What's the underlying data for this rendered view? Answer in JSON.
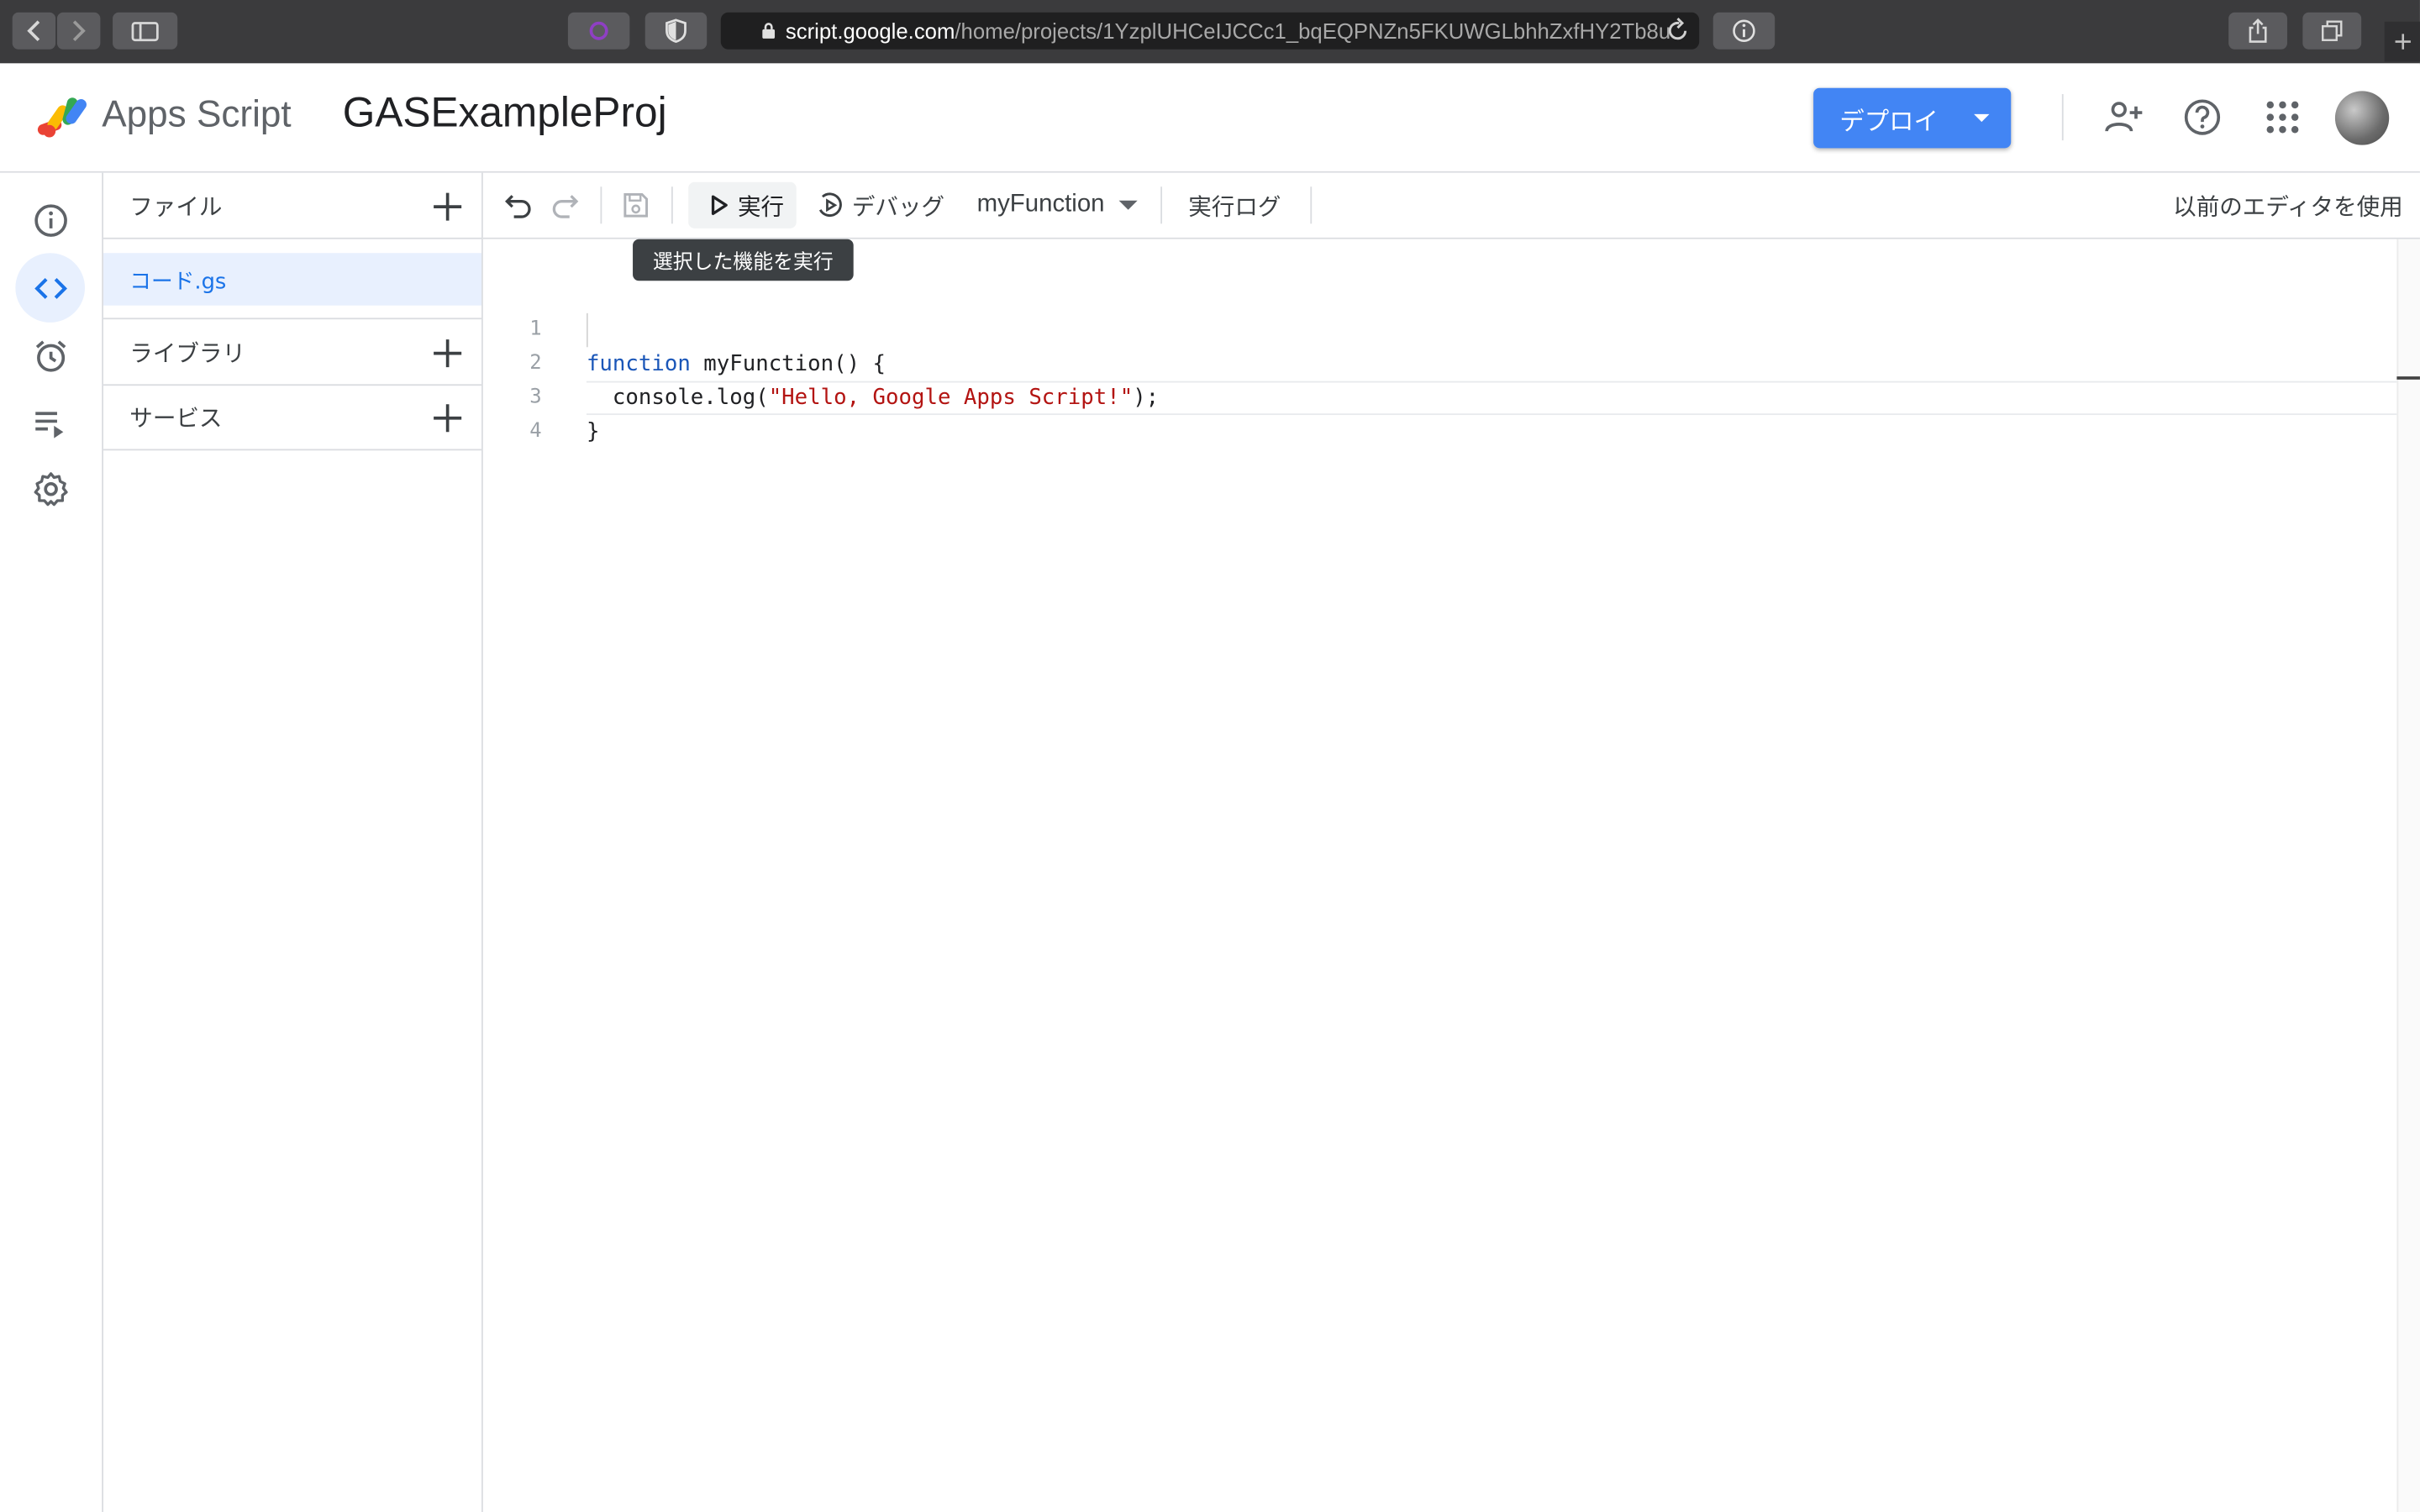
{
  "browser": {
    "url_host": "script.google.com",
    "url_path": "/home/projects/1YzplUHCeIJCCc1_bqEQPNZn5FKUWGLbhhZxfHY2Tb8u",
    "icons": [
      "back-icon",
      "forward-icon",
      "sidebar-icon",
      "extension-icon",
      "shield-icon",
      "lock-icon",
      "reload-icon",
      "info-icon",
      "share-icon",
      "tabs-icon",
      "new-tab-icon"
    ]
  },
  "header": {
    "app_name": "Apps Script",
    "project_title": "GASExampleProj",
    "deploy_label": "デプロイ",
    "accent": "#4285f4",
    "icons": [
      "add-person-icon",
      "help-icon",
      "apps-grid-icon"
    ]
  },
  "rail": {
    "items": [
      "info-icon",
      "code-icon",
      "alarm-icon",
      "executions-icon",
      "settings-icon"
    ],
    "active": "code-icon"
  },
  "files_panel": {
    "files_title": "ファイル",
    "file_name": "コード.gs",
    "libraries_title": "ライブラリ",
    "services_title": "サービス"
  },
  "toolbar": {
    "run_label": "実行",
    "debug_label": "デバッグ",
    "function_name": "myFunction",
    "log_label": "実行ログ",
    "legacy_label": "以前のエディタを使用",
    "tooltip": "選択した機能を実行"
  },
  "editor": {
    "line_numbers": [
      "1",
      "2",
      "3",
      "4"
    ],
    "line1_kw": "function",
    "line1_rest": " myFunction() {",
    "line2_pre": "  console.log(",
    "line2_str": "\"Hello, Google Apps Script!\"",
    "line2_post": ");",
    "line3": "}"
  }
}
